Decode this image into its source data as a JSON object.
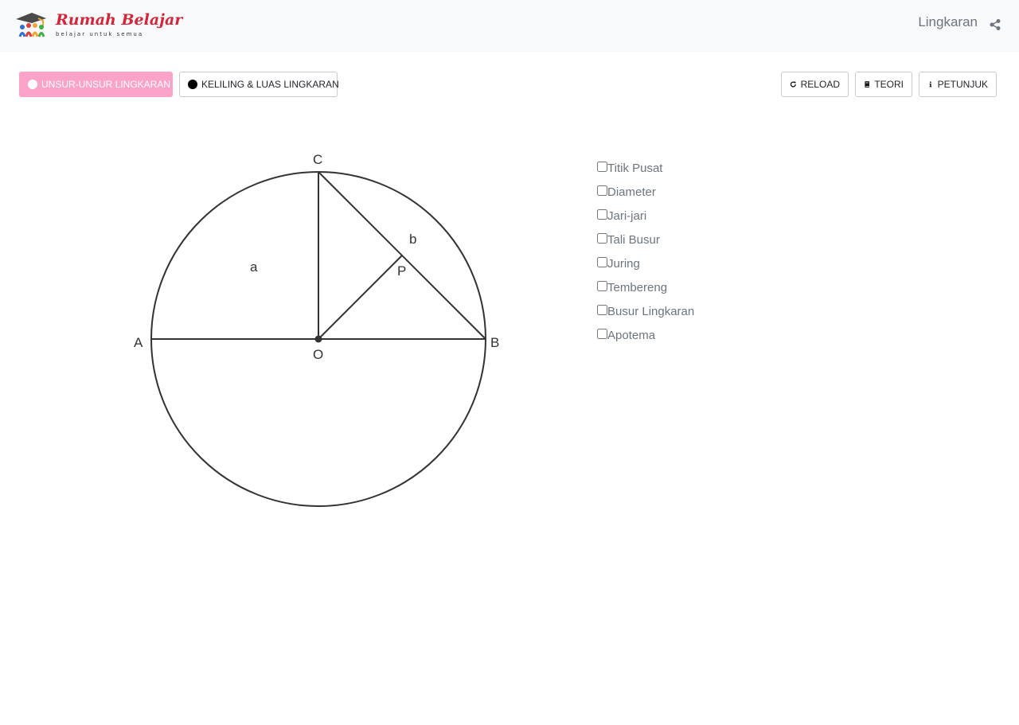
{
  "header": {
    "logo_title": "Rumah Belajar",
    "logo_tagline": "belajar untuk semua",
    "title": "Lingkaran",
    "share_icon": "share-icon"
  },
  "toolbar": {
    "tabs": [
      {
        "label": "UNSUR-UNSUR LINGKARAN",
        "active": true
      },
      {
        "label": "KELILING & LUAS LINGKARAN",
        "active": false
      }
    ],
    "actions": [
      {
        "label": "RELOAD",
        "icon": "reload-icon"
      },
      {
        "label": "TEORI",
        "icon": "book-icon"
      },
      {
        "label": "PETUNJUK",
        "icon": "info-icon"
      }
    ]
  },
  "diagram": {
    "points": {
      "A": "A",
      "B": "B",
      "C": "C",
      "O": "O",
      "P": "P"
    },
    "regions": {
      "a": "a",
      "b": "b"
    }
  },
  "options": [
    {
      "label": "Titik Pusat",
      "checked": false
    },
    {
      "label": "Diameter",
      "checked": false
    },
    {
      "label": "Jari-jari",
      "checked": false
    },
    {
      "label": "Tali Busur",
      "checked": false
    },
    {
      "label": "Juring",
      "checked": false
    },
    {
      "label": "Tembereng",
      "checked": false
    },
    {
      "label": "Busur Lingkaran",
      "checked": false
    },
    {
      "label": "Apotema",
      "checked": false
    }
  ],
  "colors": {
    "accent": "#fba3c9",
    "brand": "#d3263a",
    "text_muted": "#6c757d"
  }
}
